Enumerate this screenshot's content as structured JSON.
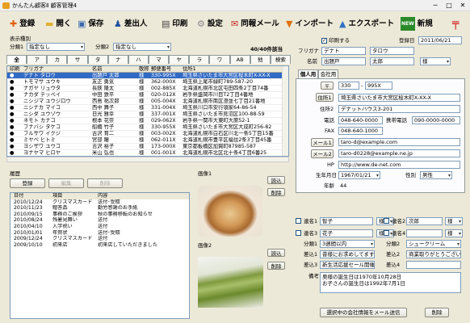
{
  "window": {
    "title": "かんたん顧客Ⅱ 顧客管理4",
    "controls": [
      "─",
      "□",
      "✕"
    ]
  },
  "toolbar": {
    "items": [
      {
        "label": "登録",
        "icon": "✚",
        "color": "#e06010"
      },
      {
        "label": "開く",
        "icon": "▬",
        "color": "#e0b030"
      },
      {
        "label": "保存",
        "icon": "▣",
        "color": "#3a6ab0"
      },
      {
        "label": "差出人",
        "icon": "♟",
        "color": "#2050a0"
      },
      {
        "label": "印刷",
        "icon": "▤",
        "color": "#444"
      },
      {
        "label": "設定",
        "icon": "⚙",
        "color": "#888"
      },
      {
        "label": "同報メール",
        "icon": "✉",
        "color": "#c02020"
      },
      {
        "label": "インポート",
        "icon": "▼",
        "color": "#e07010"
      },
      {
        "label": "エクスポート",
        "icon": "▲",
        "color": "#3070c0"
      },
      {
        "label": "新規",
        "icon": "NEW",
        "color": "#2a8a2a"
      }
    ],
    "exit_icon": "╤"
  },
  "filter": {
    "group_label": "表示種別",
    "class1_label": "分類1",
    "class1_value": "指定なし",
    "class2_label": "分類2",
    "class2_value": "指定なし",
    "count": "40/40件該当"
  },
  "kana_tabs": [
    "全",
    "ア",
    "カ",
    "サ",
    "タ",
    "ナ",
    "ハ",
    "マ",
    "ヤ",
    "ラ",
    "ワ",
    "AB",
    "他",
    "検索"
  ],
  "grid": {
    "headers": [
      "印刷",
      "フリガナ",
      "名前",
      "敬称",
      "郵便番号",
      "住所1"
    ],
    "rows": [
      [
        "●",
        "デナト タロウ",
        "出題戸 太郎",
        "様",
        "330-995X",
        "埼玉県さいたま市大宮区桜木町X-XX-X"
      ],
      [
        "●",
        "トモマサ ユウキ",
        "友正 勇気",
        "様",
        "362-000X",
        "埼玉県上尾市緑町789-587-20"
      ],
      [
        "●",
        "ナガヤ リュウタ",
        "長鋏 隆太",
        "様",
        "002-885X",
        "北海道札幌市北区屯田四条2丁目74番"
      ],
      [
        "●",
        "ナカダ テッペイ",
        "中田 鉄平",
        "様",
        "020-012X",
        "岩手県盛岡市川目T2丁目4番地"
      ],
      [
        "●",
        "ニシジマ ユウジロウ",
        "西島 祐次郎",
        "様",
        "005-004X",
        "北海道札幌市南区澄並七丁目21番地"
      ],
      [
        "●",
        "ニシナカ マイコ",
        "西中 舞子",
        "様",
        "331-004X",
        "埼玉県川口市安行領家64-86-54"
      ],
      [
        "●",
        "ニシダ ユウゾウ",
        "日光 雅幸",
        "様",
        "337-001X",
        "埼玉県さいたま市見沼区100-88-59"
      ],
      [
        "●",
        "ネモト カナコ",
        "根本 花奈",
        "様",
        "029-062X",
        "岩手県一関市大東町大原52-1"
      ],
      [
        "●",
        "フナバシ タケコ",
        "船橋 竹子",
        "様",
        "330-955X",
        "埼玉県さいたま市大宮区大成町256-82"
      ],
      [
        "●",
        "フルサワ イクジ",
        "古沢 育二",
        "様",
        "003-002X",
        "北海道札幌市白石区川北一条5丁目15番"
      ],
      [
        "●",
        "ミヤベ ヒトミ",
        "宮部 瞳",
        "様",
        "062-011X",
        "北海道札幌市豊平区福住2条3丁目45番"
      ],
      [
        "●",
        "ヨシザワ ユウコ",
        "吉沢 裕子",
        "様",
        "173-000X",
        "東京都板橋区加賀町87985-587"
      ],
      [
        "●",
        "ヨナヤマ ヒロヤ",
        "米山 弘也",
        "様",
        "001-001X",
        "北海道札幌市北区北十条4丁目6番25"
      ]
    ]
  },
  "history": {
    "title": "履歴",
    "buttons": [
      "登録",
      "編集",
      "削除"
    ],
    "headers": [
      "日付",
      "項目",
      "内容"
    ],
    "rows": [
      [
        "2010/12/24",
        "クリスマスカード",
        "送付･受取"
      ],
      [
        "2010/11/23",
        "贈答品",
        "勤労感謝のお手紙"
      ],
      [
        "2010/09/15",
        "事務のご挨拶",
        "秋の事務移転のお知らせ"
      ],
      [
        "2010/08/24",
        "残暑見舞い",
        "送付"
      ],
      [
        "2010/04/10",
        "入学祝い",
        "送付"
      ],
      [
        "2010/01/01",
        "年賀状",
        "送付･受取"
      ],
      [
        "2009/12/24",
        "クリスマスカード",
        "送付"
      ],
      [
        "2009/10/10",
        "初来店",
        "初来店していただきました"
      ]
    ]
  },
  "images": {
    "label1": "画像1",
    "label2": "画像2",
    "load": "読込",
    "delete": "削除"
  },
  "detail": {
    "print_label": "印刷する",
    "reg_label": "登録日",
    "reg_date": "2011/06/21",
    "furigana_label": "フリガナ",
    "furigana_last": "デナト",
    "furigana_first": "タロウ",
    "name_label": "名前",
    "name_last": "出題戸",
    "name_first": "太郎",
    "honorific": "様",
    "tab_personal": "個人用",
    "tab_company": "会社用",
    "zip_label": "〒",
    "zip1": "330",
    "zip2": "995X",
    "addr1_label": "住所1",
    "addr1": "埼玉県さいたま市大宮区桜木町X-XX-X",
    "addr2_label": "住所2",
    "addr2": "デナットハウス3-201",
    "tel_label": "電話",
    "tel": "048-640-0000",
    "mobile_label": "携帯電話",
    "mobile": "090-0000-0000",
    "fax_label": "FAX",
    "fax": "048-640-1000",
    "mail1_label": "メール1",
    "mail1": "taro-d@example.com",
    "mail2_label": "メール2",
    "mail2": "taro-d0228@example.ne.jp",
    "hp_label": "HP",
    "hp": "http://www.de-net.com",
    "birth_label": "生年月日",
    "birth": "1967/01/21",
    "sex_label": "性別",
    "sex": "男性",
    "age_label": "年齢",
    "age": "44",
    "joint1_label": "連名1",
    "joint1": "智子",
    "joint1_h": "様",
    "joint2_label": "連名2",
    "joint2": "次郎",
    "joint2_h": "様",
    "joint3_label": "連名3",
    "joint3": "花子",
    "joint3_h": "様",
    "joint4_label": "連名4",
    "joint4": "",
    "joint4_h": "様",
    "cls1_label": "分類1",
    "cls1": "3週間以内",
    "cls2_label": "分類2",
    "cls2": "シュークリーム",
    "ins1_label": "差込1",
    "ins1": "昔様にお求めしてます",
    "ins2_label": "差込2",
    "ins2": "商業取りがとうございまし",
    "ins3_label": "差込3",
    "ins3": "新生活応援セール開催",
    "ins4_label": "差込4",
    "ins4": "",
    "memo_label": "備考",
    "memo1": "奥様の誕生日は1970年10月28日",
    "memo2": "お子さんの誕生日は1992年7月1日",
    "send_button": "選択中の会社情報をメール送信",
    "delete_button": "削除"
  }
}
